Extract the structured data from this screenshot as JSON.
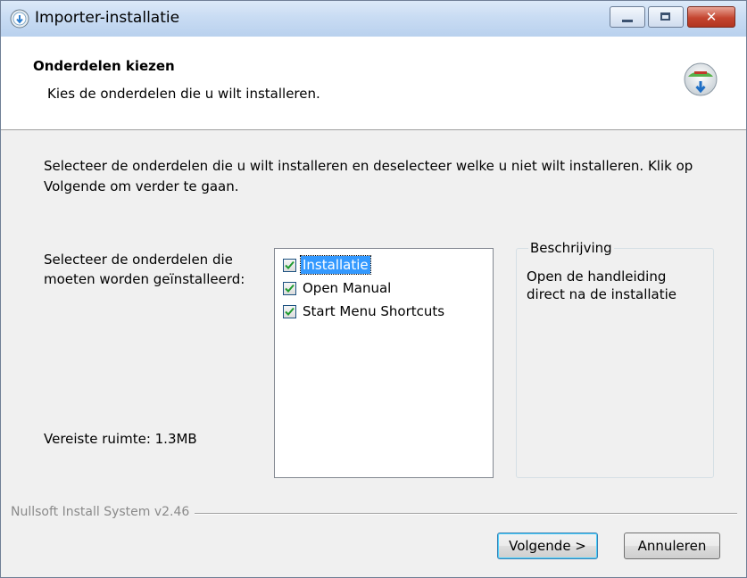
{
  "window": {
    "title": "Importer-installatie"
  },
  "titlebar_buttons": {
    "close_symbol": "✕"
  },
  "header": {
    "title": "Onderdelen kiezen",
    "subtitle": "Kies de onderdelen die u wilt installeren."
  },
  "main": {
    "intro": "Selecteer de onderdelen die u wilt installeren en deselecteer welke u niet wilt installeren. Klik op Volgende om verder te gaan.",
    "select_label": "Selecteer de onderdelen die moeten worden geïnstalleerd:",
    "space_label": "Vereiste ruimte: 1.3MB",
    "components": [
      {
        "label": "Installatie",
        "checked": true,
        "selected": true
      },
      {
        "label": "Open Manual",
        "checked": true,
        "selected": false
      },
      {
        "label": "Start Menu Shortcuts",
        "checked": true,
        "selected": false
      }
    ],
    "description": {
      "legend": "Beschrijving",
      "text": "Open de handleiding direct na de installatie"
    }
  },
  "footer": {
    "brand": "Nullsoft Install System v2.46",
    "next_label": "Volgende >",
    "cancel_label": "Annuleren"
  },
  "colors": {
    "accent": "#3399ff",
    "check": "#1f9b2f"
  }
}
